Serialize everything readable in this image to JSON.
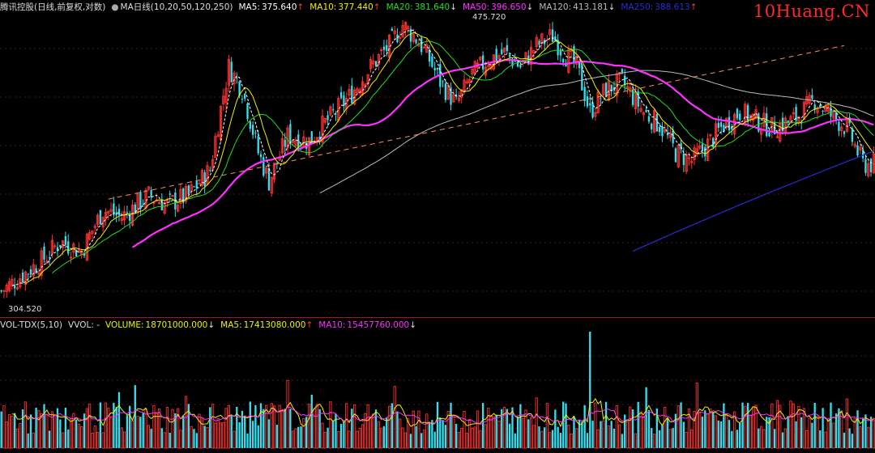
{
  "header": {
    "title": "腾讯控股(日线,前复权,对数)",
    "indicator": "MA日线(10,20,50,120,250)",
    "ma_items": [
      {
        "label": "MA5:",
        "value": "375.640",
        "arrow": "↑",
        "color": "#ffffff"
      },
      {
        "label": "MA10:",
        "value": "377.440",
        "arrow": "↑",
        "color": "#f0f000"
      },
      {
        "label": "MA20:",
        "value": "381.640",
        "arrow": "↓",
        "color": "#22dd22"
      },
      {
        "label": "MA50:",
        "value": "396.650",
        "arrow": "↓",
        "color": "#ff30ff"
      },
      {
        "label": "MA120:",
        "value": "413.181",
        "arrow": "↓",
        "color": "#bbbbbb"
      },
      {
        "label": "MA250:",
        "value": "388.613",
        "arrow": "↑",
        "color": "#2b2bd8"
      }
    ]
  },
  "watermark": "10Huang.CN",
  "price_labels": {
    "high": "475.720",
    "low": "304.520"
  },
  "volume_header": {
    "name": "VOL-TDX(5,10)",
    "vvol": "VVOL: -",
    "items": [
      {
        "label": "VOLUME:",
        "value": "18701000.000",
        "arrow": "↓",
        "color": "#f0f000"
      },
      {
        "label": "MA5:",
        "value": "17413080.000",
        "arrow": "↑",
        "color": "#f0f000"
      },
      {
        "label": "MA10:",
        "value": "15457760.000",
        "arrow": "↓",
        "color": "#ff30ff"
      }
    ]
  },
  "colors": {
    "up": "#ff3030",
    "down": "#33e0f0",
    "ma5": "#ffffff",
    "ma10": "#f0f000",
    "ma20": "#22dd22",
    "ma50": "#ff30ff",
    "ma120": "#bbbbbb",
    "ma250": "#2b2bd8",
    "trendline": "#ff8855"
  },
  "chart_data": {
    "type": "candlestick",
    "scale": "log",
    "ylim": [
      300,
      480
    ],
    "price_anchors": [
      [
        0,
        310
      ],
      [
        8,
        318
      ],
      [
        15,
        325
      ],
      [
        22,
        335
      ],
      [
        30,
        330
      ],
      [
        38,
        352
      ],
      [
        45,
        348
      ],
      [
        55,
        360
      ],
      [
        62,
        355
      ],
      [
        70,
        360
      ],
      [
        78,
        375
      ],
      [
        85,
        440
      ],
      [
        90,
        425
      ],
      [
        96,
        385
      ],
      [
        100,
        368
      ],
      [
        107,
        395
      ],
      [
        115,
        392
      ],
      [
        122,
        405
      ],
      [
        130,
        420
      ],
      [
        138,
        440
      ],
      [
        145,
        455
      ],
      [
        150,
        470
      ],
      [
        156,
        458
      ],
      [
        160,
        445
      ],
      [
        164,
        430
      ],
      [
        170,
        415
      ],
      [
        176,
        435
      ],
      [
        182,
        445
      ],
      [
        188,
        450
      ],
      [
        194,
        440
      ],
      [
        200,
        455
      ],
      [
        206,
        462
      ],
      [
        210,
        450
      ],
      [
        215,
        440
      ],
      [
        220,
        410
      ],
      [
        226,
        425
      ],
      [
        232,
        430
      ],
      [
        240,
        410
      ],
      [
        246,
        402
      ],
      [
        252,
        385
      ],
      [
        258,
        380
      ],
      [
        264,
        390
      ],
      [
        270,
        402
      ],
      [
        276,
        410
      ],
      [
        282,
        405
      ],
      [
        288,
        400
      ],
      [
        296,
        405
      ],
      [
        304,
        418
      ],
      [
        310,
        408
      ],
      [
        316,
        400
      ],
      [
        322,
        378
      ],
      [
        326,
        378
      ]
    ],
    "candle_count": 327,
    "volume_spike_index": 220,
    "trendlines": [
      {
        "name": "resistance",
        "from": [
          40,
          358
        ],
        "to": [
          315,
          455
        ],
        "style": "dashed"
      }
    ]
  }
}
